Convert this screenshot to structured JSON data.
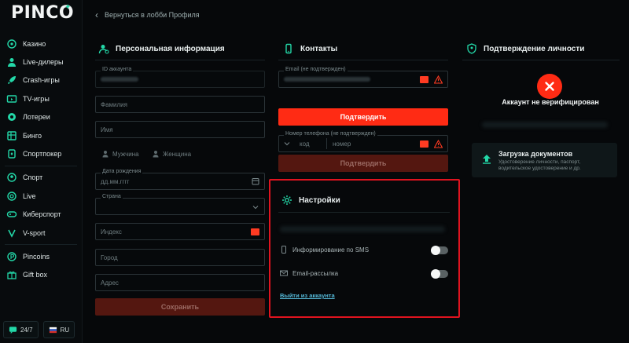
{
  "brand": {
    "logo": "PINCO",
    "accent": "#23d8a8",
    "primary": "#ff2b14"
  },
  "sidebar": {
    "items": [
      {
        "label": "Казино",
        "icon": "casino-icon"
      },
      {
        "label": "Live-дилеры",
        "icon": "live-dealer-icon"
      },
      {
        "label": "Crash-игры",
        "icon": "rocket-icon"
      },
      {
        "label": "TV-игры",
        "icon": "tv-icon"
      },
      {
        "label": "Лотереи",
        "icon": "lottery-icon"
      },
      {
        "label": "Бинго",
        "icon": "bingo-icon"
      },
      {
        "label": "Спортпокер",
        "icon": "sportpoker-icon"
      },
      {
        "label": "Спорт",
        "icon": "sport-icon"
      },
      {
        "label": "Live",
        "icon": "live-icon"
      },
      {
        "label": "Киберспорт",
        "icon": "gamepad-icon"
      },
      {
        "label": "V-sport",
        "icon": "vsport-icon"
      },
      {
        "label": "Pincoins",
        "icon": "coin-icon"
      },
      {
        "label": "Gift box",
        "icon": "gift-icon"
      }
    ],
    "support_label": "24/7",
    "language_label": "RU"
  },
  "header": {
    "back_label": "Вернуться в лобби Профиля"
  },
  "personal": {
    "title": "Персональная информация",
    "account_id_label": "ID аккаунта",
    "surname_placeholder": "Фамилия",
    "name_placeholder": "Имя",
    "gender_male": "Мужчина",
    "gender_female": "Женщина",
    "birthdate_label": "Дата рождения",
    "birthdate_placeholder": "дд.мм.гггг",
    "country_label": "Страна",
    "zip_placeholder": "Индекс",
    "city_placeholder": "Город",
    "address_placeholder": "Адрес",
    "save_label": "Сохранить"
  },
  "contacts": {
    "title": "Контакты",
    "email_label": "Email (не подтвержден)",
    "confirm_label": "Подтвердить",
    "phone_label": "Номер телефона (не подтвержден)",
    "code_placeholder": "код",
    "number_placeholder": "номер",
    "confirm_phone_label": "Подтвердить"
  },
  "settings": {
    "title": "Настройки",
    "sms_label": "Информирование по SMS",
    "email_label": "Email-рассылка",
    "logout_label": "Выйти из аккаунта"
  },
  "verification": {
    "title": "Подтверждение личности",
    "status": "Аккаунт не верифицирован",
    "upload_title": "Загрузка документов",
    "upload_desc": "Удостоверение личности, паспорт, водительское удостоверение и др."
  }
}
